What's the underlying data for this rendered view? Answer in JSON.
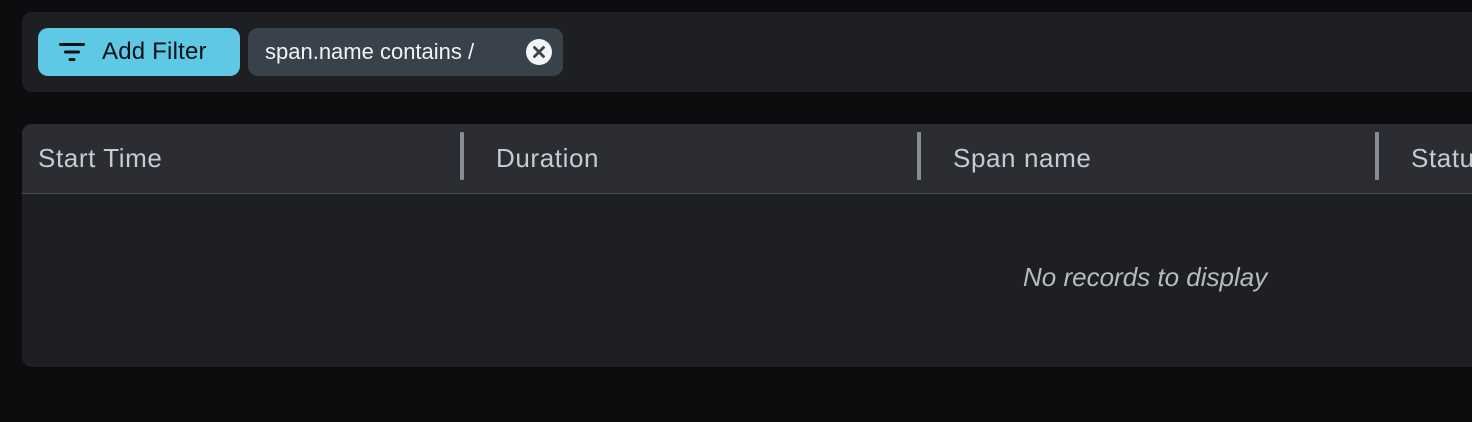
{
  "filters": {
    "add_filter_label": "Add Filter",
    "add_filter_icon": "filter-lines-icon",
    "active_chips": [
      {
        "label": "span.name contains /",
        "close_icon": "close-circle-icon"
      }
    ]
  },
  "table": {
    "columns": [
      {
        "label": "Start Time"
      },
      {
        "label": "Duration"
      },
      {
        "label": "Span name"
      },
      {
        "label": "Status"
      }
    ],
    "empty_message": "No records to display"
  },
  "colors": {
    "page_background": "#0d0d10",
    "panel_background": "#1e1f23",
    "header_background": "#2b2d33",
    "accent": "#5ec8e5",
    "chip_background": "#39414a"
  }
}
